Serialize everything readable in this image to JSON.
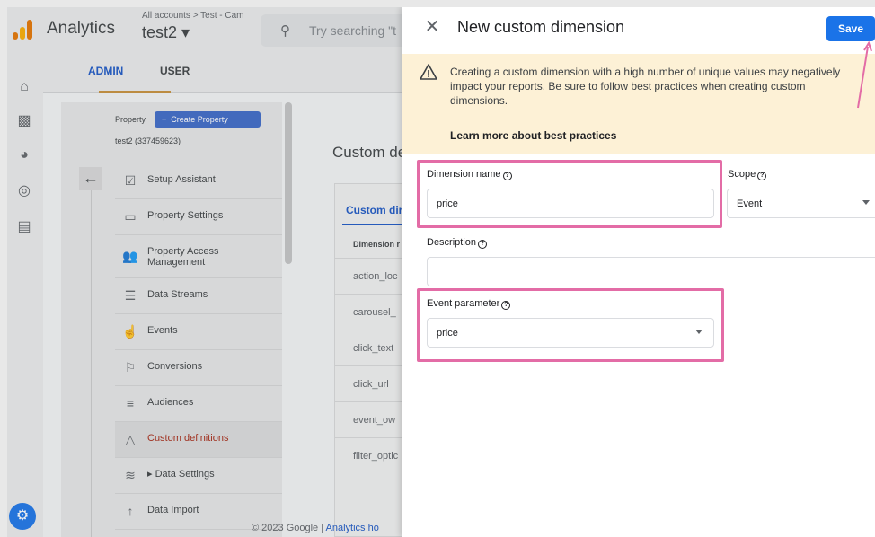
{
  "app": {
    "name": "Analytics",
    "account_crumb": "All accounts > Test - Cam",
    "account_name": "test2 ▾",
    "search_placeholder": "Try searching \"t"
  },
  "admin_tabs": {
    "admin": "ADMIN",
    "user": "USER"
  },
  "property": {
    "label": "Property",
    "create_button": "Create Property",
    "id": "test2 (337459623)"
  },
  "nav": [
    {
      "icon": "checklist-icon",
      "glyph": "☑",
      "label": "Setup Assistant"
    },
    {
      "icon": "window-icon",
      "glyph": "▭",
      "label": "Property Settings"
    },
    {
      "icon": "people-icon",
      "glyph": "👥",
      "label": "Property Access Management"
    },
    {
      "icon": "streams-icon",
      "glyph": "☰",
      "label": "Data Streams"
    },
    {
      "icon": "touch-icon",
      "glyph": "☝",
      "label": "Events"
    },
    {
      "icon": "flag-icon",
      "glyph": "⚐",
      "label": "Conversions"
    },
    {
      "icon": "audience-icon",
      "glyph": "≡",
      "label": "Audiences"
    },
    {
      "icon": "shapes-icon",
      "glyph": "△",
      "label": "Custom definitions"
    },
    {
      "icon": "database-icon",
      "glyph": "≋",
      "label": "▸ Data Settings"
    },
    {
      "icon": "upload-icon",
      "glyph": "↑",
      "label": "Data Import"
    }
  ],
  "custom_defs": {
    "title": "Custom de",
    "tab": "Custom dir",
    "column_header": "Dimension r",
    "rows": [
      "action_loc",
      "carousel_",
      "click_text",
      "click_url",
      "event_ow",
      "filter_optic"
    ]
  },
  "footer": {
    "text": "© 2023 Google | ",
    "link": "Analytics ho"
  },
  "sheet": {
    "title": "New custom dimension",
    "save": "Save",
    "warning": "Creating a custom dimension with a high number of unique values may negatively impact your reports. Be sure to follow best practices when creating custom dimensions.",
    "warning_link": "Learn more about best practices",
    "dimension_name_label": "Dimension name",
    "dimension_name_value": "price",
    "scope_label": "Scope",
    "scope_value": "Event",
    "description_label": "Description",
    "description_value": "",
    "event_parameter_label": "Event parameter",
    "event_parameter_value": "price"
  },
  "colors": {
    "accent": "#1a73e8",
    "highlight": "#e36ca6",
    "warning_bg": "#fdf1d6"
  }
}
